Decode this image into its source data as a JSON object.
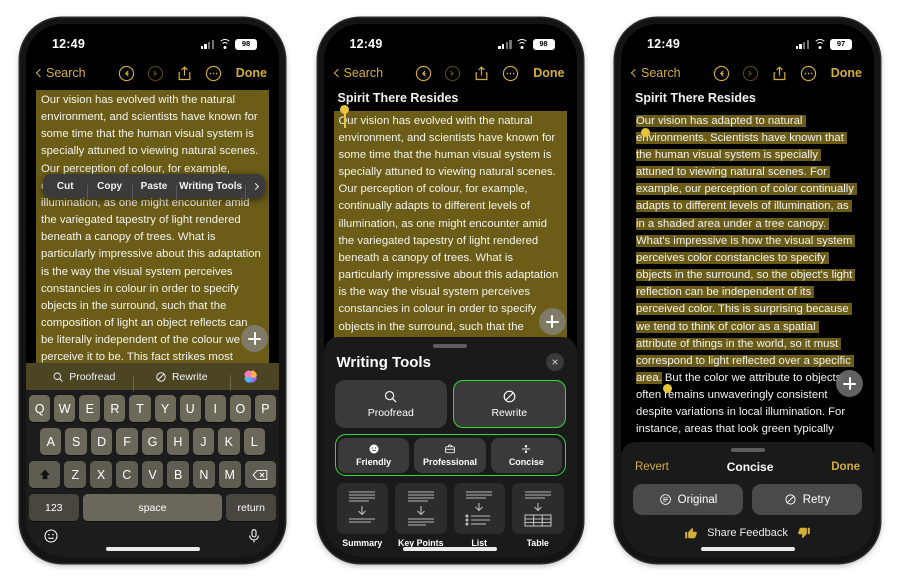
{
  "phones": [
    {
      "id": "phone-edit-menu",
      "status": {
        "time": "12:49",
        "battery": "98"
      },
      "nav": {
        "back_label": "Search",
        "done_label": "Done",
        "icons": [
          "undo-icon",
          "redo-icon",
          "share-icon",
          "more-icon"
        ]
      },
      "note": {
        "body": "Our vision has evolved with the natural environment, and scientists have known for some time that the human visual system is specially attuned to viewing natural scenes. Our perception of colour, for example, continually adapts to different levels of illumination, as one might encounter amid the variegated tapestry of light rendered beneath a canopy of trees. What is particularly impressive about this adaptation is the way the visual system perceives constancies in colour in order to specify objects in the surround, such that the composition of light an object reflects can be literally independent of the colour we perceive it to be. This fact strikes most"
      },
      "context_menu": {
        "items": [
          "Cut",
          "Copy",
          "Paste",
          "Writing Tools"
        ],
        "more_icon": "chevron-right-icon"
      },
      "suggestion_bar": {
        "proofread": "Proofread",
        "rewrite": "Rewrite",
        "ai_icon": "apple-intelligence-icon"
      },
      "keyboard": {
        "row1": [
          "Q",
          "W",
          "E",
          "R",
          "T",
          "Y",
          "U",
          "I",
          "O",
          "P"
        ],
        "row2": [
          "A",
          "S",
          "D",
          "F",
          "G",
          "H",
          "J",
          "K",
          "L"
        ],
        "row3": [
          "Z",
          "X",
          "C",
          "V",
          "B",
          "N",
          "M"
        ],
        "shift_icon": "shift-up-icon",
        "delete_icon": "backspace-icon",
        "numbers_label": "123",
        "space_label": "space",
        "return_label": "return",
        "emoji_icon": "emoji-smiley-icon",
        "dictation_icon": "microphone-icon"
      }
    },
    {
      "id": "phone-writing-tools",
      "status": {
        "time": "12:49",
        "battery": "98"
      },
      "nav": {
        "back_label": "Search",
        "done_label": "Done"
      },
      "note": {
        "title": "Spirit There Resides",
        "body": "Our vision has evolved with the natural environment, and scientists have known for some time that the human visual system is specially attuned to viewing natural scenes. Our perception of colour, for example, continually adapts to different levels of illumination, as one might encounter amid the variegated tapestry of light rendered beneath a canopy of trees. What is particularly impressive about this adaptation is the way the visual system perceives constancies in colour in order to specify objects in the surround, such that the composition of light an object reflects"
      },
      "writing_tools": {
        "title": "Writing Tools",
        "close_icon": "close-icon",
        "primary": [
          {
            "label": "Proofread",
            "icon": "magnifier-icon",
            "selected": false
          },
          {
            "label": "Rewrite",
            "icon": "rewrite-slash-circle-icon",
            "selected": true
          }
        ],
        "tones": [
          {
            "label": "Friendly",
            "icon": "smiley-face-icon"
          },
          {
            "label": "Professional",
            "icon": "briefcase-icon"
          },
          {
            "label": "Concise",
            "icon": "division-icon"
          }
        ],
        "tones_group_selected": true,
        "documents": [
          {
            "label": "Summary",
            "icon": "doc-summary-icon"
          },
          {
            "label": "Key Points",
            "icon": "doc-keypoints-icon"
          },
          {
            "label": "List",
            "icon": "doc-list-icon"
          },
          {
            "label": "Table",
            "icon": "doc-table-icon"
          }
        ]
      }
    },
    {
      "id": "phone-rewrite-result",
      "status": {
        "time": "12:49",
        "battery": "97"
      },
      "nav": {
        "back_label": "Search",
        "done_label": "Done"
      },
      "note": {
        "title": "Spirit There Resides",
        "body_highlighted": "Our vision has adapted to natural environments. Scientists have known that the human visual system is specially attuned to viewing natural scenes. For example, our perception of color continually adapts to different levels of illumination, as in a shaded area under a tree canopy. What's impressive is how the visual system perceives color constancies to specify objects in the surround, so the object's light reflection can be independent of its perceived color. This is surprising because we tend to think of color as a spatial attribute of things in the world, so it must correspond to light reflected over a specific area.",
        "body_trailing": " But the color we attribute to objects often remains unwaveringly consistent despite variations in local illumination. For instance, areas that look green typically"
      },
      "result_bar": {
        "revert_label": "Revert",
        "title": "Concise",
        "done_label": "Done",
        "buttons": [
          {
            "label": "Original",
            "icon": "original-lines-circle-icon"
          },
          {
            "label": "Retry",
            "icon": "retry-slash-circle-icon"
          }
        ],
        "feedback_label": "Share Feedback",
        "thumbs_up_icon": "thumbs-up-icon",
        "thumbs_down_icon": "thumbs-down-icon"
      }
    }
  ],
  "colors": {
    "accent_gold": "#d4af37",
    "highlight_olive": "#6b5d17",
    "selection_green": "#2ddb3f",
    "handle_yellow": "#e8c53a",
    "sheet_bg": "#1a1a1a"
  }
}
